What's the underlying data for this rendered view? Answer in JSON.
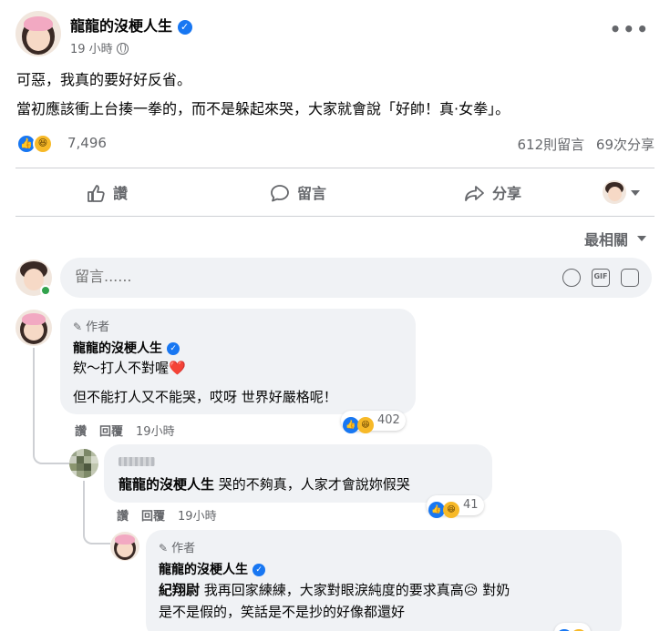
{
  "post": {
    "author_name": "龍龍的沒梗人生",
    "verified_glyph": "✓",
    "time": "19 小時",
    "more_glyph": "•••",
    "line1": "可惡，我真的要好好反省。",
    "line2": "當初應該衝上台揍一拳的，而不是躲起來哭，大家就會說「好帥！真·女拳」。",
    "reaction_count": "7,496",
    "comments_count": "612則留言",
    "shares_count": "69次分享",
    "reactions": [
      "like",
      "haha"
    ]
  },
  "actions": {
    "like_label": "讚",
    "comment_label": "留言",
    "share_label": "分享"
  },
  "sort": {
    "label": "最相關"
  },
  "composer": {
    "placeholder": "留言......",
    "gif_label": "GIF"
  },
  "comments": [
    {
      "author_tag": "作者",
      "name": "龍龍的沒梗人生",
      "line1": "欸～打人不對喔❤️",
      "line2": "但不能打人又不能哭，哎呀 世界好嚴格呢！",
      "like_label": "讚",
      "reply_label": "回覆",
      "time": "19小時",
      "reaction_count": "402"
    },
    {
      "mention": "龍龍的沒梗人生",
      "text": "哭的不夠真，人家才會說妳假哭",
      "like_label": "讚",
      "reply_label": "回覆",
      "time": "19小時",
      "reaction_count": "41"
    },
    {
      "author_tag": "作者",
      "name": "龍龍的沒梗人生",
      "mention": "紀翔尉",
      "line1": "我再回家練練，大家對眼淚純度的要求真高😥 對奶",
      "line2": "是不是假的，笑話是不是抄的好像都還好"
    }
  ],
  "colors": {
    "like": "#1877f2",
    "haha": "#f7b928",
    "online": "#31a24c",
    "bubble": "#f0f2f5",
    "secondary_text": "#65676b"
  }
}
